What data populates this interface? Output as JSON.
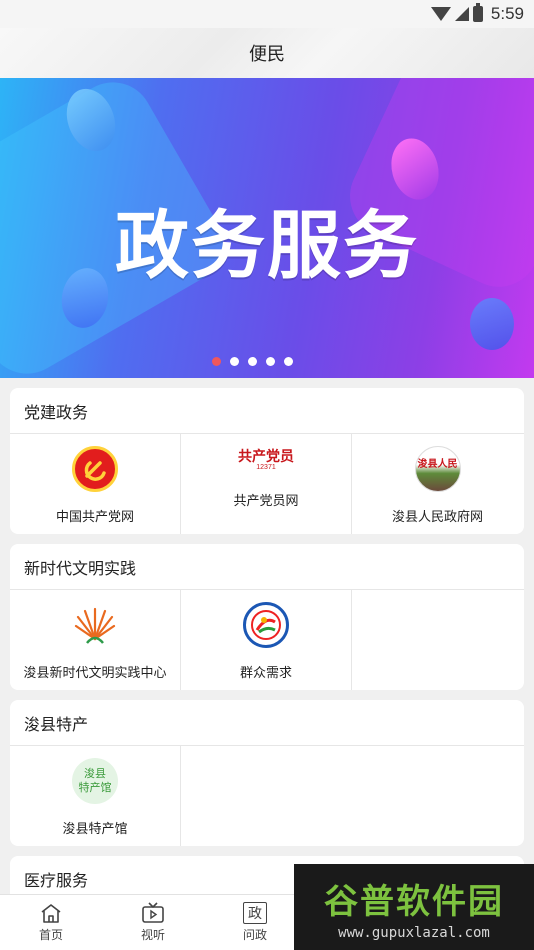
{
  "status_bar": {
    "time": "5:59"
  },
  "header": {
    "title": "便民"
  },
  "banner": {
    "title": "政务服务",
    "dots": 5,
    "active_dot": 1
  },
  "sections": [
    {
      "title": "党建政务",
      "items": [
        {
          "label": "中国共产党网",
          "icon": "party-emblem-icon"
        },
        {
          "label": "共产党员网",
          "icon": "party-member-logo-icon",
          "logo_text": "共产党员",
          "logo_sub": "12371"
        },
        {
          "label": "浚县人民政府网",
          "icon": "county-government-logo-icon",
          "logo_text": "浚县人民"
        }
      ]
    },
    {
      "title": "新时代文明实践",
      "items": [
        {
          "label": "浚县新时代文明实践中心",
          "icon": "civilization-center-logo-icon"
        },
        {
          "label": "群众需求",
          "icon": "public-demand-logo-icon"
        }
      ]
    },
    {
      "title": "浚县特产",
      "items": [
        {
          "label": "浚县特产馆",
          "icon": "specialty-store-icon",
          "logo_line1": "浚县",
          "logo_line2": "特产馆"
        }
      ]
    },
    {
      "title": "医疗服务",
      "items": []
    }
  ],
  "tabbar": [
    {
      "label": "首页",
      "icon": "home-icon"
    },
    {
      "label": "视听",
      "icon": "tv-icon"
    },
    {
      "label": "问政",
      "icon": "gov-question-icon",
      "glyph": "政"
    }
  ],
  "watermark": {
    "title": "谷普软件园",
    "url": "www.gupuxlazal.com"
  },
  "colors": {
    "active_dot": "#f0575d",
    "party_red": "#e21d1d",
    "watermark_green": "#7dc23f"
  }
}
